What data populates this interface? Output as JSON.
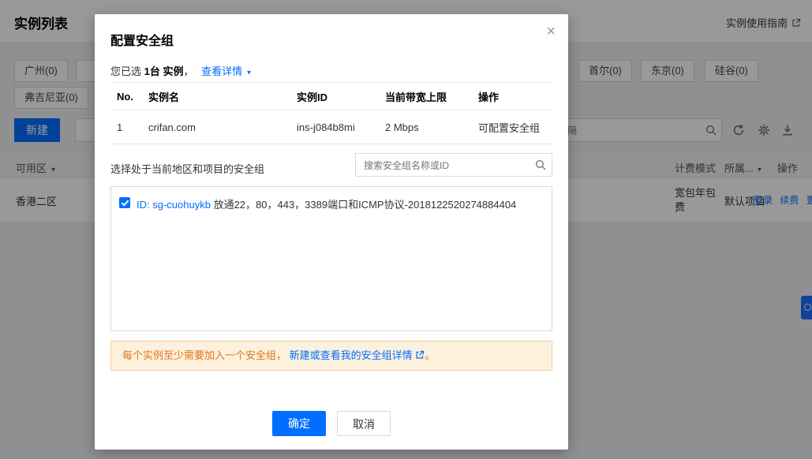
{
  "icons": {
    "close": "×",
    "caret_down": "▼"
  },
  "colors": {
    "accent": "#006eff",
    "warning_text": "#e37318",
    "warning_bg": "#fcf1dd"
  },
  "page": {
    "title": "实例列表",
    "guide_link": "实例使用指南",
    "regions_left": [
      "广州(0)"
    ],
    "regions_right": [
      "首尔(0)",
      "东京(0)",
      "硅谷(0)"
    ],
    "regions_row2": [
      "弗吉尼亚(0)"
    ],
    "create_button": "新建",
    "filter_placeholder": "过滤标签用回车键分隔",
    "table": {
      "col_zone": "可用区",
      "col_billing": "计费模式",
      "col_project": "所属...",
      "col_action": "操作",
      "row": {
        "zone": "香港二区",
        "billing": "宽包年包费",
        "project": "默认项目",
        "action_login": "登录",
        "action_renew": "续费",
        "action_more": "更多"
      }
    }
  },
  "modal": {
    "title": "配置安全组",
    "selected_prefix": "您已选",
    "selected_count": "1台 实例",
    "selected_comma": "，",
    "detail_link": "查看详情",
    "table": {
      "headers": [
        "No.",
        "实例名",
        "实例ID",
        "当前带宽上限",
        "操作"
      ],
      "row": {
        "no": "1",
        "name": "crifan.com",
        "id": "ins-j084b8mi",
        "bandwidth": "2 Mbps",
        "action": "可配置安全组"
      }
    },
    "sg_label": "选择处于当前地区和项目的安全组",
    "sg_search_placeholder": "搜索安全组名称或ID",
    "sg_item": {
      "checked": true,
      "id_label": "ID: sg-cuohuykb",
      "desc": "放通22，80，443，3389端口和ICMP协议-2018122520274884404"
    },
    "warning_text": "每个实例至少需要加入一个安全组，",
    "warning_link": "新建或查看我的安全组详情",
    "warning_suffix": "。",
    "confirm": "确定",
    "cancel": "取消"
  }
}
